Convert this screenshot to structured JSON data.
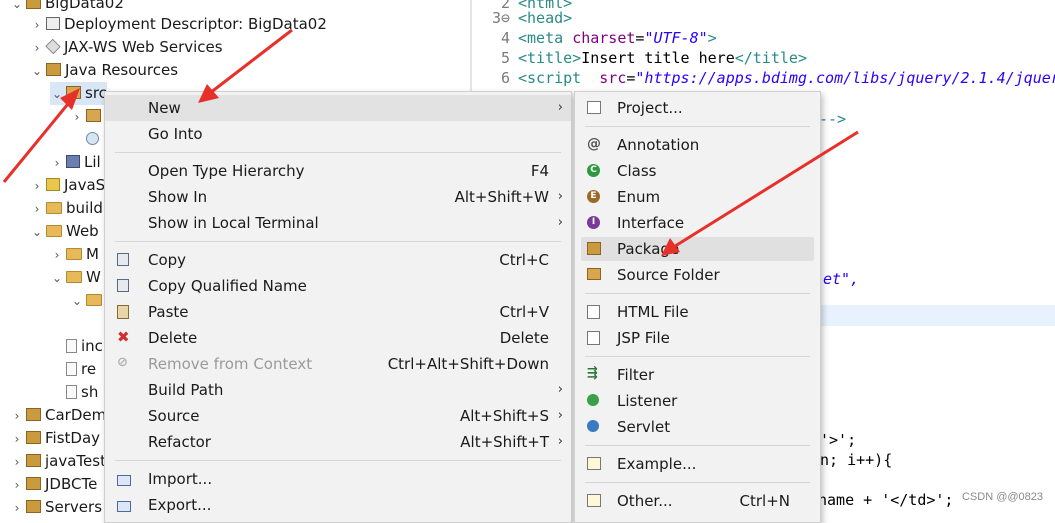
{
  "tree": {
    "rows": [
      {
        "twisty": "⌄",
        "label": "BigData02"
      },
      {
        "twisty": "›",
        "label": "Deployment Descriptor: BigData02"
      },
      {
        "twisty": "›",
        "label": "JAX-WS Web Services"
      },
      {
        "twisty": "⌄",
        "label": "Java Resources"
      },
      {
        "twisty": "⌄",
        "label": "src"
      },
      {
        "twisty": "›",
        "label": ""
      },
      {
        "twisty": "",
        "label": ""
      },
      {
        "twisty": "›",
        "label": "Lil"
      },
      {
        "twisty": "›",
        "label": "JavaS"
      },
      {
        "twisty": "›",
        "label": "build"
      },
      {
        "twisty": "⌄",
        "label": "Web"
      },
      {
        "twisty": "›",
        "label": "M"
      },
      {
        "twisty": "⌄",
        "label": "W"
      },
      {
        "twisty": "⌄",
        "label": ""
      },
      {
        "twisty": "",
        "label": ""
      },
      {
        "twisty": "",
        "label": "inc"
      },
      {
        "twisty": "",
        "label": "re"
      },
      {
        "twisty": "",
        "label": "sh"
      },
      {
        "twisty": "›",
        "label": "CarDem"
      },
      {
        "twisty": "›",
        "label": "FistDay"
      },
      {
        "twisty": "›",
        "label": "javaTest"
      },
      {
        "twisty": "›",
        "label": "JDBCTe"
      },
      {
        "twisty": "›",
        "label": "Servers"
      }
    ]
  },
  "editor": {
    "lines": [
      {
        "num": "2",
        "parts": [
          {
            "c": "tag",
            "t": "<html>"
          }
        ]
      },
      {
        "num": "3⊖",
        "parts": [
          {
            "c": "tag",
            "t": "<head>"
          }
        ]
      },
      {
        "num": "4",
        "parts": [
          {
            "c": "tag",
            "t": "<meta "
          },
          {
            "c": "attr",
            "t": "charset"
          },
          {
            "c": "plain",
            "t": "="
          },
          {
            "c": "str",
            "t": "\"UTF-8\""
          },
          {
            "c": "tag",
            "t": ">"
          }
        ]
      },
      {
        "num": "5",
        "parts": [
          {
            "c": "tag",
            "t": "<title>"
          },
          {
            "c": "plain",
            "t": "Insert title here"
          },
          {
            "c": "tag",
            "t": "</title>"
          }
        ]
      },
      {
        "num": "6",
        "parts": [
          {
            "c": "tag",
            "t": "<script  "
          },
          {
            "c": "attr",
            "t": "src"
          },
          {
            "c": "plain",
            "t": "="
          },
          {
            "c": "str",
            "t": "\"https://apps.bdimg.com/libs/jquery/2.1.4/jquer"
          }
        ]
      }
    ],
    "fragments": [
      "-->",
      "et\",",
      "'>';",
      "n; i++){",
      "name + '</td>';"
    ]
  },
  "menu_main": {
    "items": [
      {
        "label": "New",
        "shortcut": "",
        "arrow": "›",
        "icon": "",
        "disabled": false,
        "highlight": true
      },
      {
        "label": "Go Into",
        "shortcut": "",
        "arrow": "",
        "icon": "",
        "disabled": false
      },
      {
        "sep": true
      },
      {
        "label": "Open Type Hierarchy",
        "shortcut": "F4",
        "arrow": "",
        "icon": "",
        "disabled": false
      },
      {
        "label": "Show In",
        "shortcut": "Alt+Shift+W",
        "arrow": "›",
        "icon": "",
        "disabled": false
      },
      {
        "label": "Show in Local Terminal",
        "shortcut": "",
        "arrow": "›",
        "icon": "",
        "disabled": false
      },
      {
        "sep": true
      },
      {
        "label": "Copy",
        "shortcut": "Ctrl+C",
        "arrow": "",
        "icon": "copy-icon",
        "disabled": false
      },
      {
        "label": "Copy Qualified Name",
        "shortcut": "",
        "arrow": "",
        "icon": "copy-icon",
        "disabled": false
      },
      {
        "label": "Paste",
        "shortcut": "Ctrl+V",
        "arrow": "",
        "icon": "paste-icon",
        "disabled": false
      },
      {
        "label": "Delete",
        "shortcut": "Delete",
        "arrow": "",
        "icon": "delete-icon",
        "disabled": false
      },
      {
        "label": "Remove from Context",
        "shortcut": "Ctrl+Alt+Shift+Down",
        "arrow": "",
        "icon": "remove-icon",
        "disabled": true
      },
      {
        "label": "Build Path",
        "shortcut": "",
        "arrow": "›",
        "icon": "",
        "disabled": false
      },
      {
        "label": "Source",
        "shortcut": "Alt+Shift+S",
        "arrow": "›",
        "icon": "",
        "disabled": false
      },
      {
        "label": "Refactor",
        "shortcut": "Alt+Shift+T",
        "arrow": "›",
        "icon": "",
        "disabled": false
      },
      {
        "sep": true
      },
      {
        "label": "Import...",
        "shortcut": "",
        "arrow": "",
        "icon": "import-icon",
        "disabled": false
      },
      {
        "label": "Export...",
        "shortcut": "",
        "arrow": "",
        "icon": "export-icon",
        "disabled": false
      }
    ]
  },
  "menu_new": {
    "items": [
      {
        "label": "Project...",
        "shortcut": "",
        "icon": "project-icon"
      },
      {
        "sep": true
      },
      {
        "label": "Annotation",
        "shortcut": "",
        "icon": "annotation-icon"
      },
      {
        "label": "Class",
        "shortcut": "",
        "icon": "class-icon"
      },
      {
        "label": "Enum",
        "shortcut": "",
        "icon": "enum-icon"
      },
      {
        "label": "Interface",
        "shortcut": "",
        "icon": "interface-icon"
      },
      {
        "label": "Package",
        "shortcut": "",
        "icon": "package-icon",
        "highlight": true
      },
      {
        "label": "Source Folder",
        "shortcut": "",
        "icon": "source-folder-icon"
      },
      {
        "sep": true
      },
      {
        "label": "HTML File",
        "shortcut": "",
        "icon": "html-file-icon"
      },
      {
        "label": "JSP File",
        "shortcut": "",
        "icon": "jsp-file-icon"
      },
      {
        "sep": true
      },
      {
        "label": "Filter",
        "shortcut": "",
        "icon": "filter-icon"
      },
      {
        "label": "Listener",
        "shortcut": "",
        "icon": "listener-icon"
      },
      {
        "label": "Servlet",
        "shortcut": "",
        "icon": "servlet-icon"
      },
      {
        "sep": true
      },
      {
        "label": "Example...",
        "shortcut": "",
        "icon": "example-icon"
      },
      {
        "sep": true
      },
      {
        "label": "Other...",
        "shortcut": "Ctrl+N",
        "icon": "other-icon"
      }
    ]
  },
  "watermark": "CSDN @@0823",
  "colors": {
    "annotation_arrow": "#e8302a",
    "menu_bg": "#f2f2f2",
    "highlight": "#e2e2e2"
  }
}
